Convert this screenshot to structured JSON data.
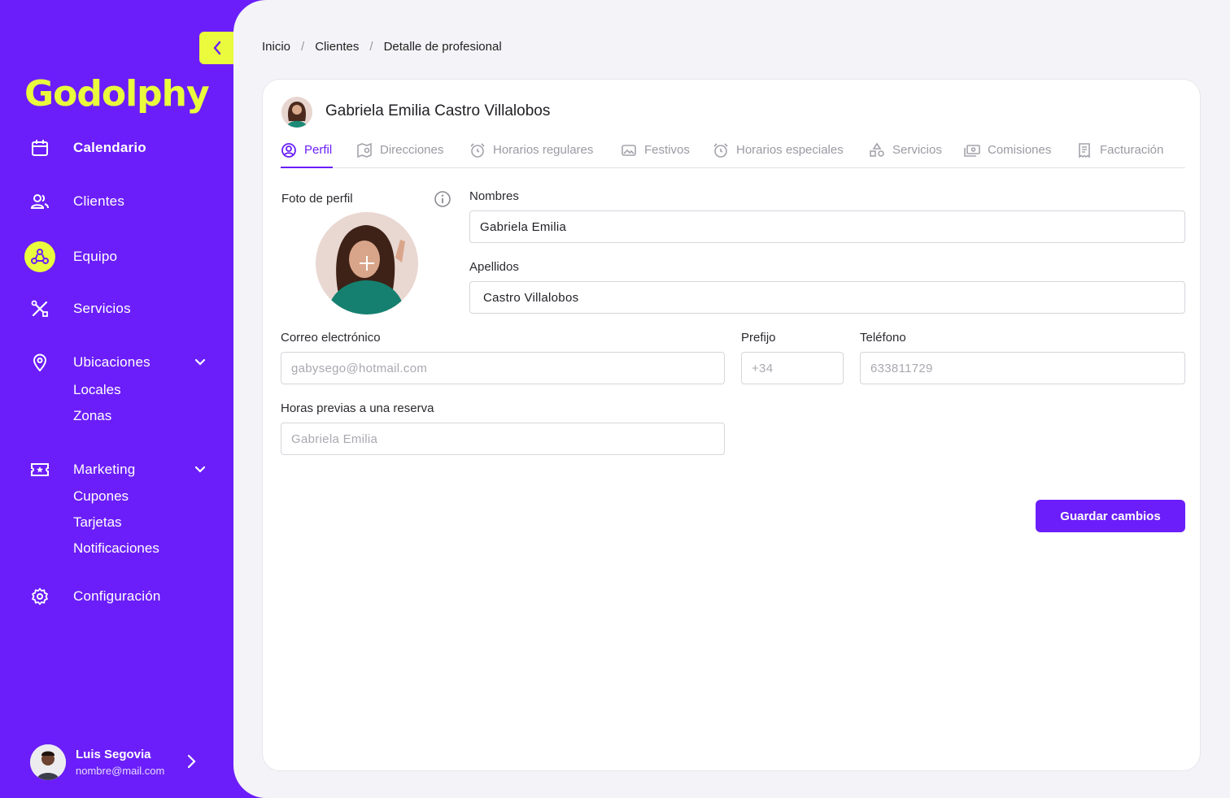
{
  "sidebar": {
    "logo": "Godolphy",
    "items": {
      "calendario": "Calendario",
      "clientes": "Clientes",
      "equipo": "Equipo",
      "servicios": "Servicios",
      "ubicaciones": "Ubicaciones",
      "locales": "Locales",
      "zonas": "Zonas",
      "marketing": "Marketing",
      "cupones": "Cupones",
      "tarjetas": "Tarjetas",
      "notificaciones": "Notificaciones",
      "configuracion": "Configuración"
    },
    "user": {
      "name": "Luis Segovia",
      "email": "nombre@mail.com"
    },
    "colors": {
      "brand": "#6b1ef9",
      "accent": "#e9fb3c"
    }
  },
  "breadcrumb": [
    "Inicio",
    "Clientes",
    "Detalle de profesional"
  ],
  "profile": {
    "full_name": "Gabriela Emilia Castro Villalobos"
  },
  "tabs": [
    "Perfil",
    "Direcciones",
    "Horarios regulares",
    "Festivos",
    "Horarios especiales",
    "Servicios",
    "Comisiones",
    "Facturación"
  ],
  "form": {
    "photo_label": "Foto de perfil",
    "nombres_label": "Nombres",
    "nombres_value": "Gabriela Emilia",
    "apellidos_label": "Apellidos",
    "apellidos_value": "Castro Villalobos",
    "correo_label": "Correo electrónico",
    "correo_placeholder": "gabysego@hotmail.com",
    "prefijo_label": "Prefijo",
    "prefijo_placeholder": "+34",
    "telefono_label": "Teléfono",
    "telefono_placeholder": "633811729",
    "horas_label": "Horas previas a una reserva",
    "horas_placeholder": "Gabriela Emilia",
    "save_label": "Guardar cambios"
  }
}
